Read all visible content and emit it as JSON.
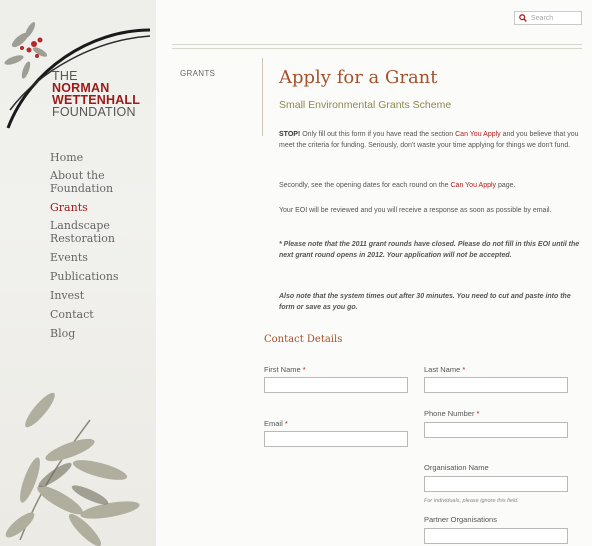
{
  "search": {
    "label": "Search"
  },
  "logo": {
    "line1": "THE",
    "line2": "NORMAN",
    "line3": "WETTENHALL",
    "line4": "FOUNDATION"
  },
  "nav": {
    "items": [
      {
        "label": "Home"
      },
      {
        "label_line1": "About the",
        "label_line2": "Foundation"
      },
      {
        "label": "Grants"
      },
      {
        "label_line1": "Landscape",
        "label_line2": "Restoration"
      },
      {
        "label": "Events"
      },
      {
        "label": "Publications"
      },
      {
        "label": "Invest"
      },
      {
        "label": "Contact"
      },
      {
        "label": "Blog"
      }
    ]
  },
  "breadcrumb": "GRANTS",
  "page": {
    "title": "Apply for a Grant",
    "subtitle": "Small Environmental Grants Scheme"
  },
  "intro": {
    "stop_bold": "STOP!",
    "stop_text1": " Only fill out this form if you have read the section ",
    "stop_link": "Can You Apply",
    "stop_text2": " and you believe that you meet the criteria for funding.  Seriously, don't waste your time applying for things we don't fund.",
    "second_text": "Secondly, see the opening dates for each round on the ",
    "second_link": "Can You Apply",
    "second_end": " page.",
    "eoi": "Your EOI will be reviewed and you will receive a response as soon as possible by email.",
    "note1": "* Please note that the 2011 grant rounds have closed.  Please do not fill in this EOI until the next grant round opens in 2012. Your application will not be accepted.",
    "note2": "Also note that the system times out after 30 minutes.  You need to cut and paste into the form or save as you go."
  },
  "form": {
    "section_title": "Contact Details",
    "first_name": "First Name",
    "last_name": "Last Name",
    "email": "Email",
    "phone": "Phone Number",
    "org_name": "Organisation Name",
    "org_help": "For individuals, please ignore this field.",
    "partners": "Partner Organisations",
    "required_mark": "*"
  }
}
